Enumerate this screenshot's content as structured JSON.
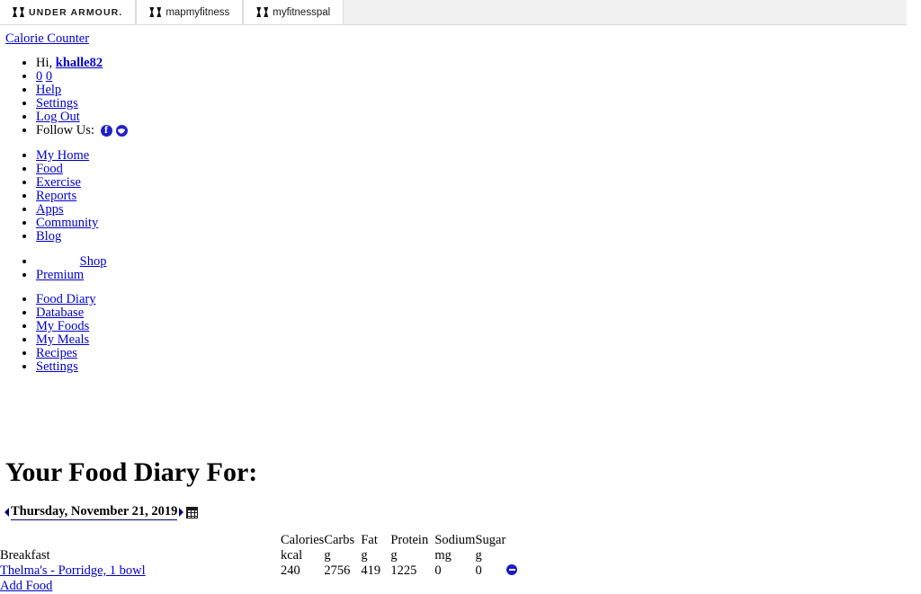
{
  "brandbar": {
    "tabs": [
      {
        "label": "UNDER ARMOUR.",
        "icon": "under-armour-logo"
      },
      {
        "label": "mapmyfitness",
        "icon": "under-armour-logo"
      },
      {
        "label": "myfitnesspal",
        "icon": "under-armour-logo"
      }
    ]
  },
  "site": {
    "home_link": "Calorie Counter"
  },
  "usermenu": {
    "greeting_prefix": "Hi,",
    "username": "khalle82",
    "messages_count": "0",
    "notifications_count": "0",
    "help": "Help",
    "settings": "Settings",
    "logout": "Log Out",
    "follow_label": "Follow Us:",
    "social": [
      {
        "name": "facebook-icon"
      },
      {
        "name": "twitter-icon"
      }
    ]
  },
  "mainnav": {
    "items": [
      {
        "label": "My Home"
      },
      {
        "label": "Food"
      },
      {
        "label": "Exercise"
      },
      {
        "label": "Reports"
      },
      {
        "label": "Apps"
      },
      {
        "label": "Community"
      },
      {
        "label": "Blog"
      }
    ]
  },
  "shopnav": {
    "items": [
      {
        "label": "Shop"
      },
      {
        "label": "Premium"
      }
    ]
  },
  "subnav": {
    "items": [
      {
        "label": "Food Diary"
      },
      {
        "label": "Database"
      },
      {
        "label": "My Foods"
      },
      {
        "label": "My Meals"
      },
      {
        "label": "Recipes"
      },
      {
        "label": "Settings"
      }
    ]
  },
  "diary": {
    "title": "Your Food Diary For:",
    "date": "Thursday, November 21, 2019",
    "prev_icon": "prev-day-arrow",
    "next_icon": "next-day-arrow",
    "calendar_icon": "calendar-icon",
    "columns": [
      {
        "header": "",
        "unit": ""
      },
      {
        "header": "Calories",
        "unit": "kcal"
      },
      {
        "header": "Carbs",
        "unit": "g"
      },
      {
        "header": "Fat",
        "unit": "g"
      },
      {
        "header": "Protein",
        "unit": "g"
      },
      {
        "header": "Sodium",
        "unit": "mg"
      },
      {
        "header": "Sugar",
        "unit": "g"
      }
    ],
    "meal": {
      "name": "Breakfast",
      "entries": [
        {
          "food": "Thelma's - Porridge, 1 bowl",
          "calories": "240",
          "carbs_a": "27",
          "carbs_b": "56",
          "fat_a": "4",
          "fat_b": "19",
          "protein_a": "12",
          "protein_b": "25",
          "sodium": "0",
          "sugar": "0",
          "remove_icon": "remove-entry-icon"
        }
      ],
      "add_food": "Add Food"
    }
  }
}
